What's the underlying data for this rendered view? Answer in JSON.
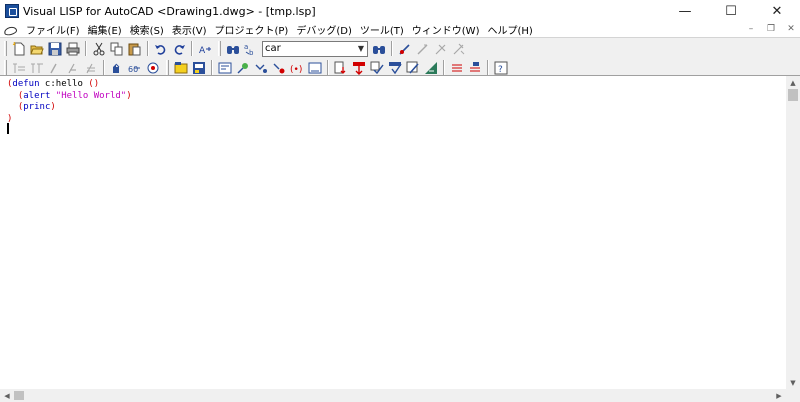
{
  "window": {
    "title": "Visual LISP for AutoCAD <Drawing1.dwg> - [tmp.lsp]",
    "controls": {
      "minimize": "—",
      "maximize": "☐",
      "close": "✕"
    }
  },
  "menubar": {
    "items": [
      "ファイル(F)",
      "編集(E)",
      "検索(S)",
      "表示(V)",
      "プロジェクト(P)",
      "デバッグ(D)",
      "ツール(T)",
      "ウィンドウ(W)",
      "ヘルプ(H)"
    ],
    "mdi_controls": {
      "minimize": "–",
      "restore": "❐",
      "close": "✕"
    }
  },
  "toolbar": {
    "search_combo_value": "car",
    "row1_icons": [
      "new-file-icon",
      "open-file-icon",
      "save-icon",
      "print-icon",
      "cut-icon",
      "copy-icon",
      "paste-icon",
      "undo-icon",
      "redo-icon",
      "complete-word-icon",
      "find-icon",
      "replace-icon",
      "find-toolbar-icon",
      "toggle-breakpoint-icon",
      "inspect-icon",
      "trace-icon",
      "watch-icon"
    ],
    "row2_icons": [
      "indent-icon",
      "unindent-icon",
      "comment-icon",
      "uncomment-icon",
      "format-icon",
      "load-selection-icon",
      "check-icon",
      "window-icon",
      "load-file-icon",
      "console-icon",
      "apropos-icon",
      "step-into-icon",
      "step-over-icon",
      "step-out-icon",
      "continue-icon",
      "quit-icon",
      "reset-icon",
      "breakpoint-list-icon",
      "last-break-icon",
      "help-icon"
    ]
  },
  "editor": {
    "lines": [
      {
        "indent": "",
        "open": "(",
        "func": "defun",
        "rest": " c:hello ",
        "tail": "()"
      },
      {
        "indent": "  ",
        "open": "(",
        "func": "alert",
        "str": "\"Hello World\"",
        "close": ")"
      },
      {
        "indent": "  ",
        "open": "(",
        "func": "princ",
        "close": ")"
      },
      {
        "close": ")"
      }
    ]
  },
  "scrollbars": {
    "up": "▲",
    "down": "▼",
    "left": "◀",
    "right": "▶"
  },
  "colors": {
    "paren": "#d10000",
    "keyword": "#0000c0",
    "string": "#c000c0",
    "toolbar_bg": "#f0f0f0"
  }
}
